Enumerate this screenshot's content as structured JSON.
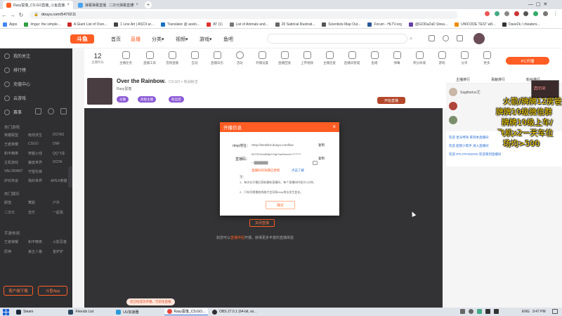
{
  "browser": {
    "tabs": [
      {
        "title": "Rasy誓復_CS:GO直播_斗鱼直播",
        "active": true
      },
      {
        "title": "弹幕弹幕直播",
        "active": false
      },
      {
        "title": "二次元弹幕直播",
        "active": false
      }
    ],
    "new_tab": "+",
    "url": "douyu.com/5470211",
    "bookmarks": [
      "Apps",
      "Imgur: the simple...",
      "A Giant List of Over...",
      "1 Line Art | ASCII ar...",
      "Translator @ acelo...",
      "AT (1)",
      "List of Animals and...",
      "20 Satirical Illustrati...",
      "Scientists Map Out...",
      "Forum - HLTV.org",
      "@GODaZaD Strea...",
      "UNICODE TEST w8...",
      "Dave2k / cheaters..."
    ]
  },
  "site": {
    "logo": "斗鱼",
    "nav": [
      {
        "label": "首页",
        "active": false
      },
      {
        "label": "直播",
        "active": true
      },
      {
        "label": "分类▾",
        "active": false
      },
      {
        "label": "视频▾",
        "active": false
      },
      {
        "label": "游戏▾",
        "active": false
      },
      {
        "label": "鱼吧",
        "active": false
      }
    ]
  },
  "sidebar": {
    "items": [
      "我的关注",
      "排行榜",
      "充值中心",
      "云游戏",
      "赛事"
    ],
    "hot_section": "热门游戏",
    "hot_games": [
      "英雄联盟",
      "绝地求生",
      "王者荣耀",
      "DOTA2",
      "和平精英",
      "CSGO",
      "穿越火线",
      "DNF",
      "主机游戏",
      "QQ飞车",
      "魔兽世界",
      "VALORANT",
      "守望先锋",
      "DOTA",
      "炉石传说",
      "我的世界",
      "APEX英雄"
    ],
    "section2": "热门娱乐",
    "ent_games": [
      "颜值",
      "舞蹈",
      "户外",
      "二次元",
      "音乐",
      "一起看"
    ],
    "section3": "手游休闲",
    "mobile_games": [
      "王者荣耀",
      "和平精英",
      "火影忍者",
      "原神",
      "第五人格",
      "金铲铲"
    ],
    "btn_open": "客户端下载",
    "btn_app": "斗鱼App"
  },
  "tools": [
    {
      "label": "主播任务"
    },
    {
      "label": "直播工具"
    },
    {
      "label": "音频直播"
    },
    {
      "label": "互动"
    },
    {
      "label": "直播日历"
    },
    {
      "label": "活动"
    },
    {
      "label": "开播设置"
    },
    {
      "label": "直播回放"
    },
    {
      "label": "上传视频"
    },
    {
      "label": "主播连麦"
    },
    {
      "label": "直播间管理"
    },
    {
      "label": "鱼塘"
    },
    {
      "label": "弹幕"
    },
    {
      "label": "积分商城"
    },
    {
      "label": "游戏"
    },
    {
      "label": "分享"
    },
    {
      "label": "更多"
    }
  ],
  "hours": {
    "value": "12",
    "label": "主播时长"
  },
  "room": {
    "title": "Over the Rainbow.",
    "streamer": "Rasy誓復",
    "meta": "CS:GO > 枪战射击",
    "tags": [
      "主播",
      "高能主播",
      "粉丝团"
    ],
    "btn_pc": "PC开播",
    "btn_start": "开始直播"
  },
  "right_panel": {
    "tabs": [
      "主播排行",
      "贡献排行",
      "粉丝排行"
    ],
    "users": [
      "Sagittarius尤",
      "",
      ""
    ],
    "chat": [
      "欢迎 星光特效 来到本直播间",
      "欢迎 超管小帮手 进入直播间",
      "欢迎 RTLYPHXDOSI 欢迎来到直播间"
    ]
  },
  "modal": {
    "title": "开播信息",
    "rtmp_label": "rtmp地址：",
    "rtmp_value": "rtmp://sendtc3.douyu.com/live",
    "code_label": "直播码：",
    "code_value": "5470211rkANfpCZqk?wsSecret=********",
    "code_value2": "=·███████",
    "copy": "复制",
    "warning": "直播码有效期已更新",
    "learn": "点击了解",
    "note_title": "注：",
    "notes": [
      "1、每次在开播后获取最新直播码，每个直播码时效为1分钟。",
      "2、只有切换播放线路才会导致rtmp地址发生变化。"
    ],
    "confirm": "确定"
  },
  "player": {
    "start_btn": "关闭直播",
    "hint_pre": "如您可以",
    "hint_link": "直播伴侣",
    "hint_post": "开播，获得更多丰富的直播体验",
    "toast": "您已经成功开播，可前往直播"
  },
  "overlay": {
    "lines": [
      "火箭/牌牌12房管",
      "牌牌10级微信群",
      "牌牌10级上车/",
      "飞机x2一天车位",
      "场均>500"
    ],
    "stream_label": "请回来"
  },
  "taskbar": {
    "tasks": [
      {
        "label": "Steam",
        "active": false
      },
      {
        "label": "Friends List",
        "active": false
      },
      {
        "label": "UU加速器",
        "active": false
      },
      {
        "label": "Rasy誓復_CS:GO...",
        "active": true
      },
      {
        "label": "OBS 27.0.1 (64-bit, wi...",
        "active": false
      }
    ],
    "lang": "ENG",
    "time": "9:47 PM"
  }
}
